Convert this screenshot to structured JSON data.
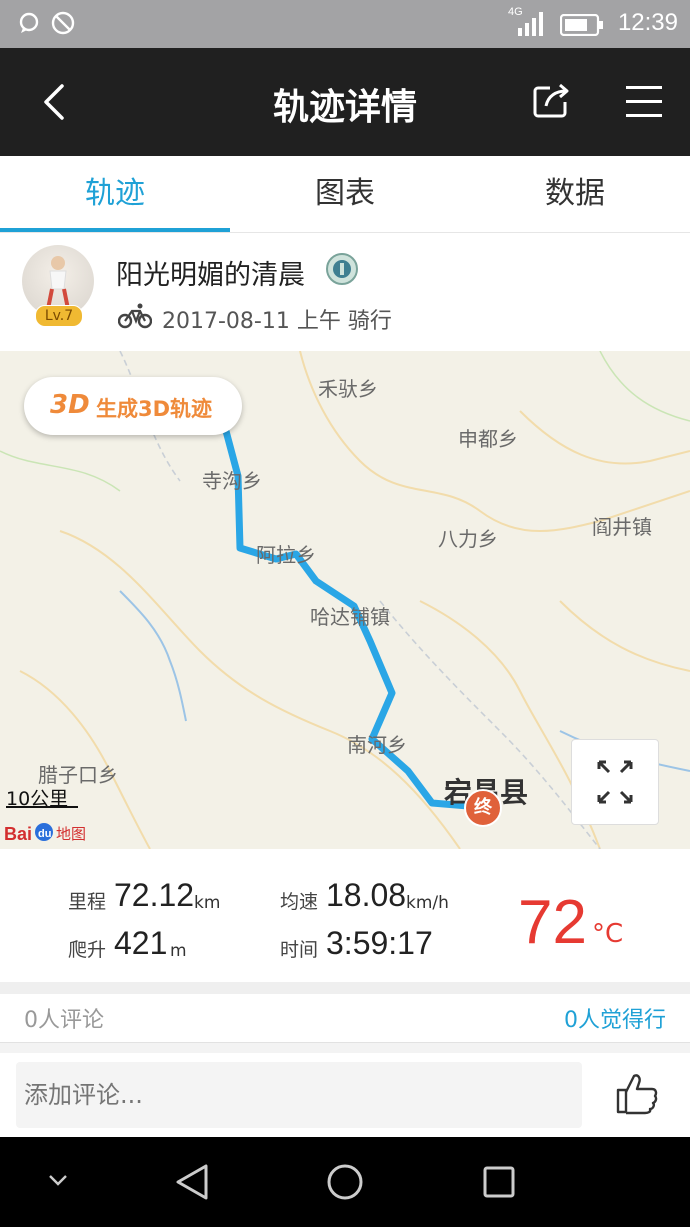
{
  "status_bar": {
    "network": "4G",
    "time": "12:39"
  },
  "header": {
    "title": "轨迹详情"
  },
  "tabs": [
    {
      "label": "轨迹",
      "active": true
    },
    {
      "label": "图表",
      "active": false
    },
    {
      "label": "数据",
      "active": false
    }
  ],
  "user": {
    "name": "阳光明媚的清晨",
    "level": "Lv.7",
    "date_type": "2017-08-11 上午 骑行"
  },
  "map": {
    "button_3d": {
      "badge": "3D",
      "label": "生成3D轨迹"
    },
    "places": [
      "禾驮乡",
      "申都乡",
      "寺沟乡",
      "阎井镇",
      "八力乡",
      "阿拉乡",
      "哈达铺镇",
      "南河乡",
      "腊子口乡",
      "宕昌县"
    ],
    "end_marker": "终",
    "scale": "10公里",
    "route_color": "#2aa6e6"
  },
  "stats": {
    "distance": {
      "label": "里程",
      "value": "72.12",
      "unit": "km"
    },
    "avg_speed": {
      "label": "均速",
      "value": "18.08",
      "unit": "km/h"
    },
    "climb": {
      "label": "爬升",
      "value": "421",
      "unit": "m"
    },
    "duration": {
      "label": "时间",
      "value": "3:59:17"
    },
    "temperature": {
      "value": "72",
      "unit": "°C",
      "color": "#e63a32"
    }
  },
  "social": {
    "comments": "0人评论",
    "likes": "0人觉得行"
  },
  "comment_input": {
    "placeholder": "添加评论..."
  },
  "accent_color": "#1fa1d6"
}
